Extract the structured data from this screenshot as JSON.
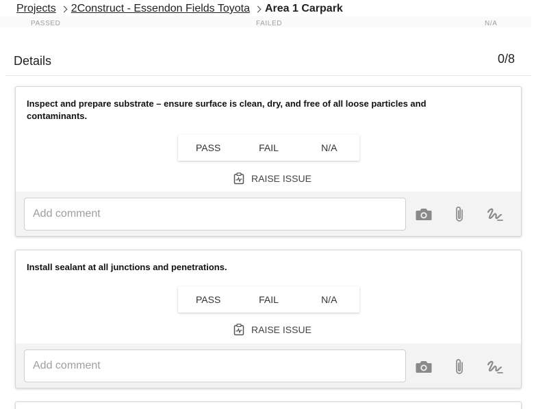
{
  "breadcrumb": {
    "items": [
      {
        "label": "Projects"
      },
      {
        "label": "2Construct - Essendon Fields Toyota"
      }
    ],
    "current": "Area 1 Carpark"
  },
  "summary": {
    "passed_label": "PASSED",
    "failed_label": "FAILED",
    "na_label": "N/A"
  },
  "details": {
    "title": "Details",
    "count": "0/8"
  },
  "checklist": [
    {
      "text": "Inspect and prepare substrate – ensure surface is clean, dry, and free of all loose particles and contaminants.",
      "pass_label": "PASS",
      "fail_label": "FAIL",
      "na_label": "N/A",
      "raise_issue_label": "RAISE ISSUE",
      "comment_placeholder": "Add comment"
    },
    {
      "text": "Install sealant at all junctions and penetrations.",
      "pass_label": "PASS",
      "fail_label": "FAIL",
      "na_label": "N/A",
      "raise_issue_label": "RAISE ISSUE",
      "comment_placeholder": "Add comment"
    }
  ],
  "icons": {
    "raise_issue": "clipboard-pulse-icon",
    "camera": "camera-icon",
    "attachment": "paperclip-icon",
    "signature": "signature-icon"
  },
  "colors": {
    "text": "#212121",
    "muted": "#9e9e9e",
    "icon": "#8a8a8a",
    "comment_bg": "#f3f3f3"
  }
}
